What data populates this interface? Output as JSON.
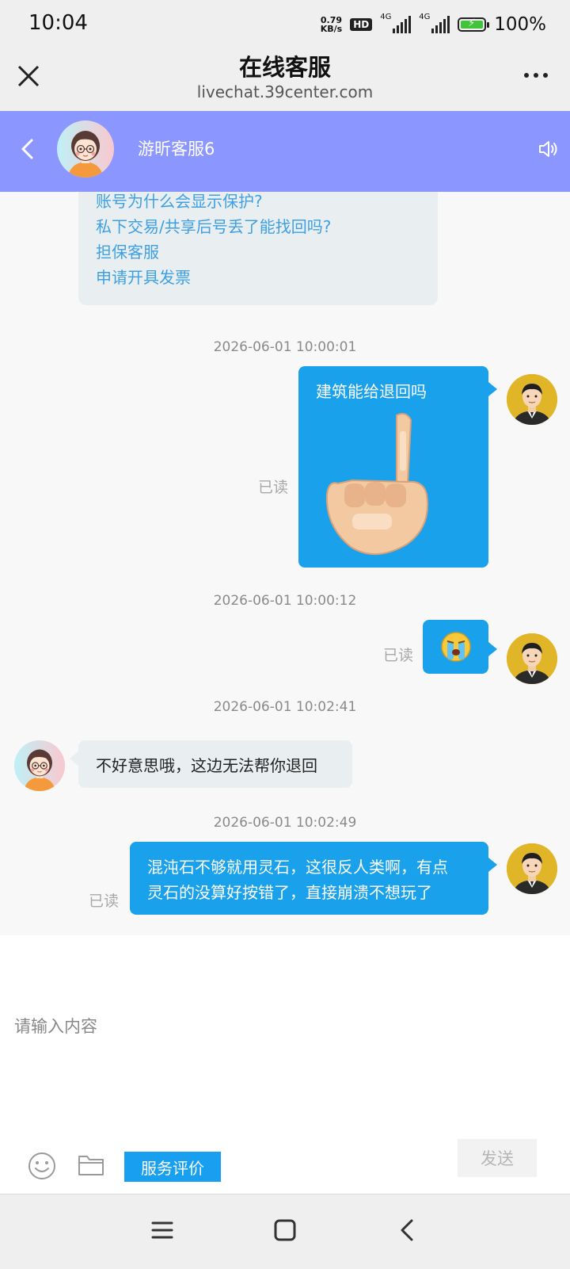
{
  "status_bar": {
    "time": "10:04",
    "net_speed_value": "0.79",
    "net_speed_unit": "KB/s",
    "hd_badge": "HD",
    "sim1_type": "4G",
    "sim2_type": "4G",
    "battery": "100%"
  },
  "browser": {
    "title": "在线客服",
    "url": "livechat.39center.com"
  },
  "chat_header": {
    "agent_name": "游昕客服6",
    "header_color": "#8c96ff"
  },
  "faq": {
    "items": [
      "账号为什么会显示保护?",
      "私下交易/共享后号丢了能找回吗?",
      "担保客服",
      "申请开具发票"
    ]
  },
  "messages": [
    {
      "timestamp": "2026-06-01 10:00:01",
      "sender": "user",
      "text": "建筑能给退回吗",
      "attachment": "pointing-hand-sticker",
      "status": "已读"
    },
    {
      "timestamp": "2026-06-01 10:00:12",
      "sender": "user",
      "attachment": "crying-face-emoji",
      "status": "已读"
    },
    {
      "timestamp": "2026-06-01 10:02:41",
      "sender": "agent",
      "text": "不好意思哦，这边无法帮你退回"
    },
    {
      "timestamp": "2026-06-01 10:02:49",
      "sender": "user",
      "text_line1": "混沌石不够就用灵石，这很反人类啊，有点",
      "text_line2": "灵石的没算好按错了，直接崩溃不想玩了",
      "status": "已读"
    }
  ],
  "input": {
    "placeholder": "请输入内容",
    "rating_label": "服务评价",
    "send_label": "发送"
  },
  "colors": {
    "user_bubble": "#1aa1ec",
    "agent_bubble": "#e9eef0",
    "faq_link": "#3ea0e3"
  }
}
